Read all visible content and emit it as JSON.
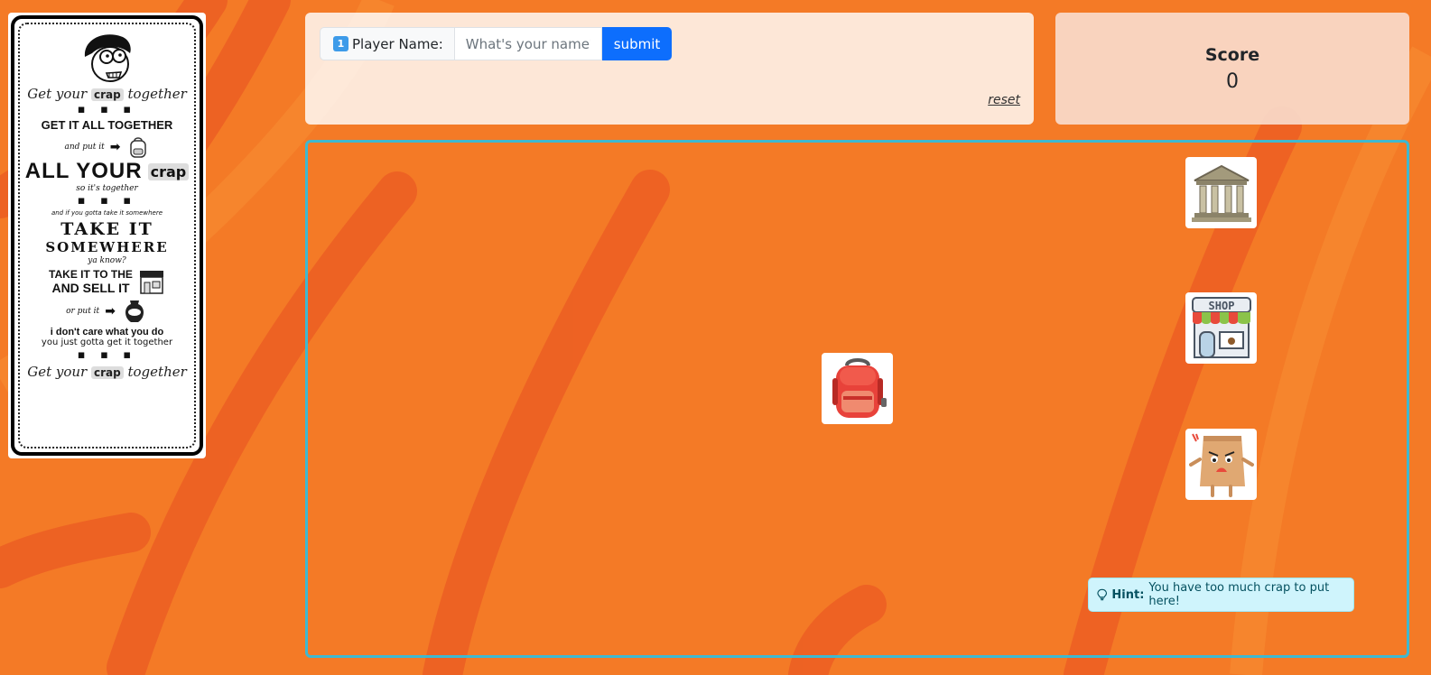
{
  "poster": {
    "line1_a": "Get your",
    "line1_chip": "crap",
    "line1_b": "together",
    "dots": "▪ ▪ ▪",
    "line2": "GET IT ALL TOGETHER",
    "line3": "and put it",
    "line4_a": "ALL YOUR",
    "line4_chip": "crap",
    "line5": "so it's together",
    "line6": "and if you gotta take it somewhere",
    "line7": "TAKE IT",
    "line8": "SOMEWHERE",
    "line9": "ya know?",
    "line10": "TAKE IT TO THE",
    "line11": "AND SELL IT",
    "line12": "or put it",
    "line13": "i don't care what you do",
    "line14": "you just gotta get it together",
    "line15_a": "Get your",
    "line15_chip": "crap",
    "line15_b": "together"
  },
  "player": {
    "badge": "1",
    "label": "Player Name:",
    "placeholder": "What's your name?",
    "value": "",
    "submit_label": "submit",
    "reset_label": "reset"
  },
  "score": {
    "title": "Score",
    "value": "0"
  },
  "items": [
    {
      "name": "backpack",
      "icon": "backpack-icon"
    },
    {
      "name": "bank",
      "icon": "bank-icon"
    },
    {
      "name": "shop",
      "icon": "shop-icon"
    },
    {
      "name": "trash-bag",
      "icon": "paper-bag-icon"
    }
  ],
  "shop_sign": "SHOP",
  "hint": {
    "label": "Hint:",
    "text": "You have too much crap to put here!"
  },
  "colors": {
    "background": "#f47a26",
    "submit": "#0d6efd",
    "play_border": "#3fb8cf",
    "hint_bg": "#cff4fc"
  }
}
